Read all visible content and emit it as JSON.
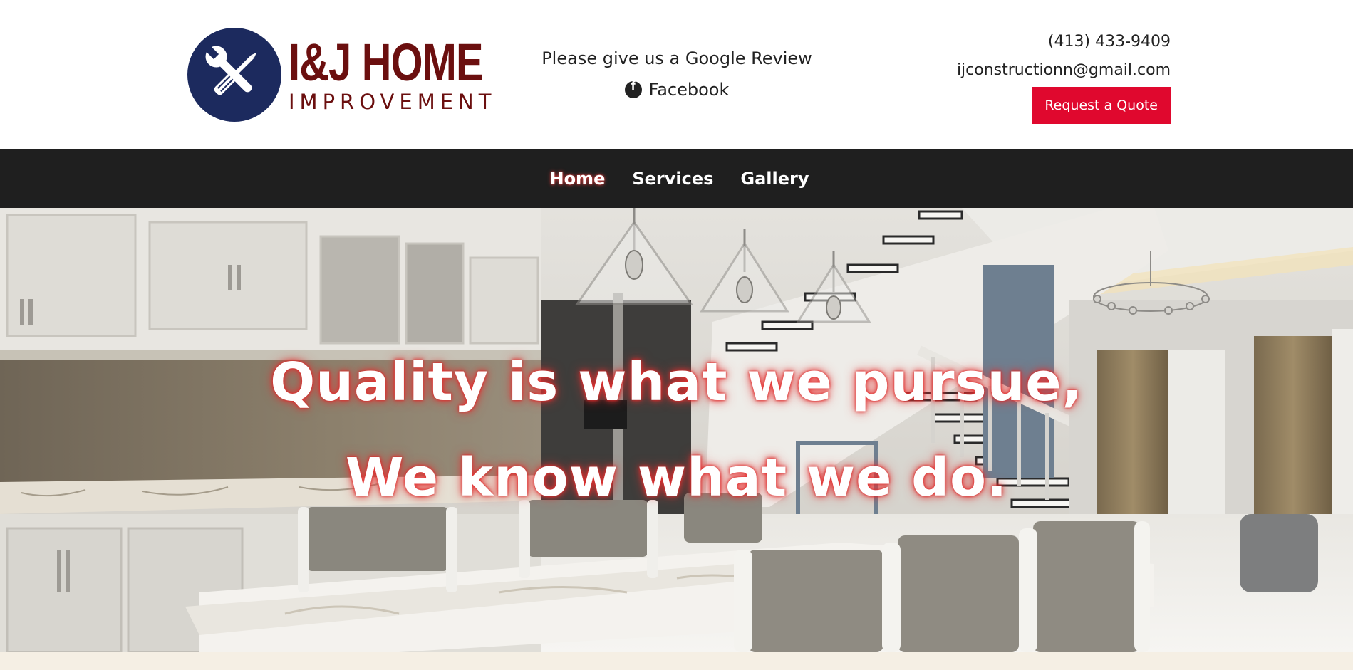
{
  "header": {
    "logo": {
      "title": "I&J HOME",
      "subtitle": "IMPROVEMENT",
      "icon": "wrench-screwdriver-icon"
    },
    "review_link": "Please give us a Google Review",
    "facebook_link": "Facebook",
    "phone": "(413) 433-9409",
    "email": "ijconstructionn@gmail.com",
    "quote_button": "Request a Quote"
  },
  "nav": {
    "items": [
      {
        "label": "Home",
        "active": true
      },
      {
        "label": "Services",
        "active": false
      },
      {
        "label": "Gallery",
        "active": false
      }
    ]
  },
  "hero": {
    "line1": "Quality is what we pursue,",
    "line2": "We know what we do."
  },
  "colors": {
    "logo_badge": "#1c2a5e",
    "logo_text": "#6b0f0f",
    "accent": "#e0082e",
    "nav_bg": "#1f1f1f",
    "bottom_band": "#f5efe4"
  }
}
